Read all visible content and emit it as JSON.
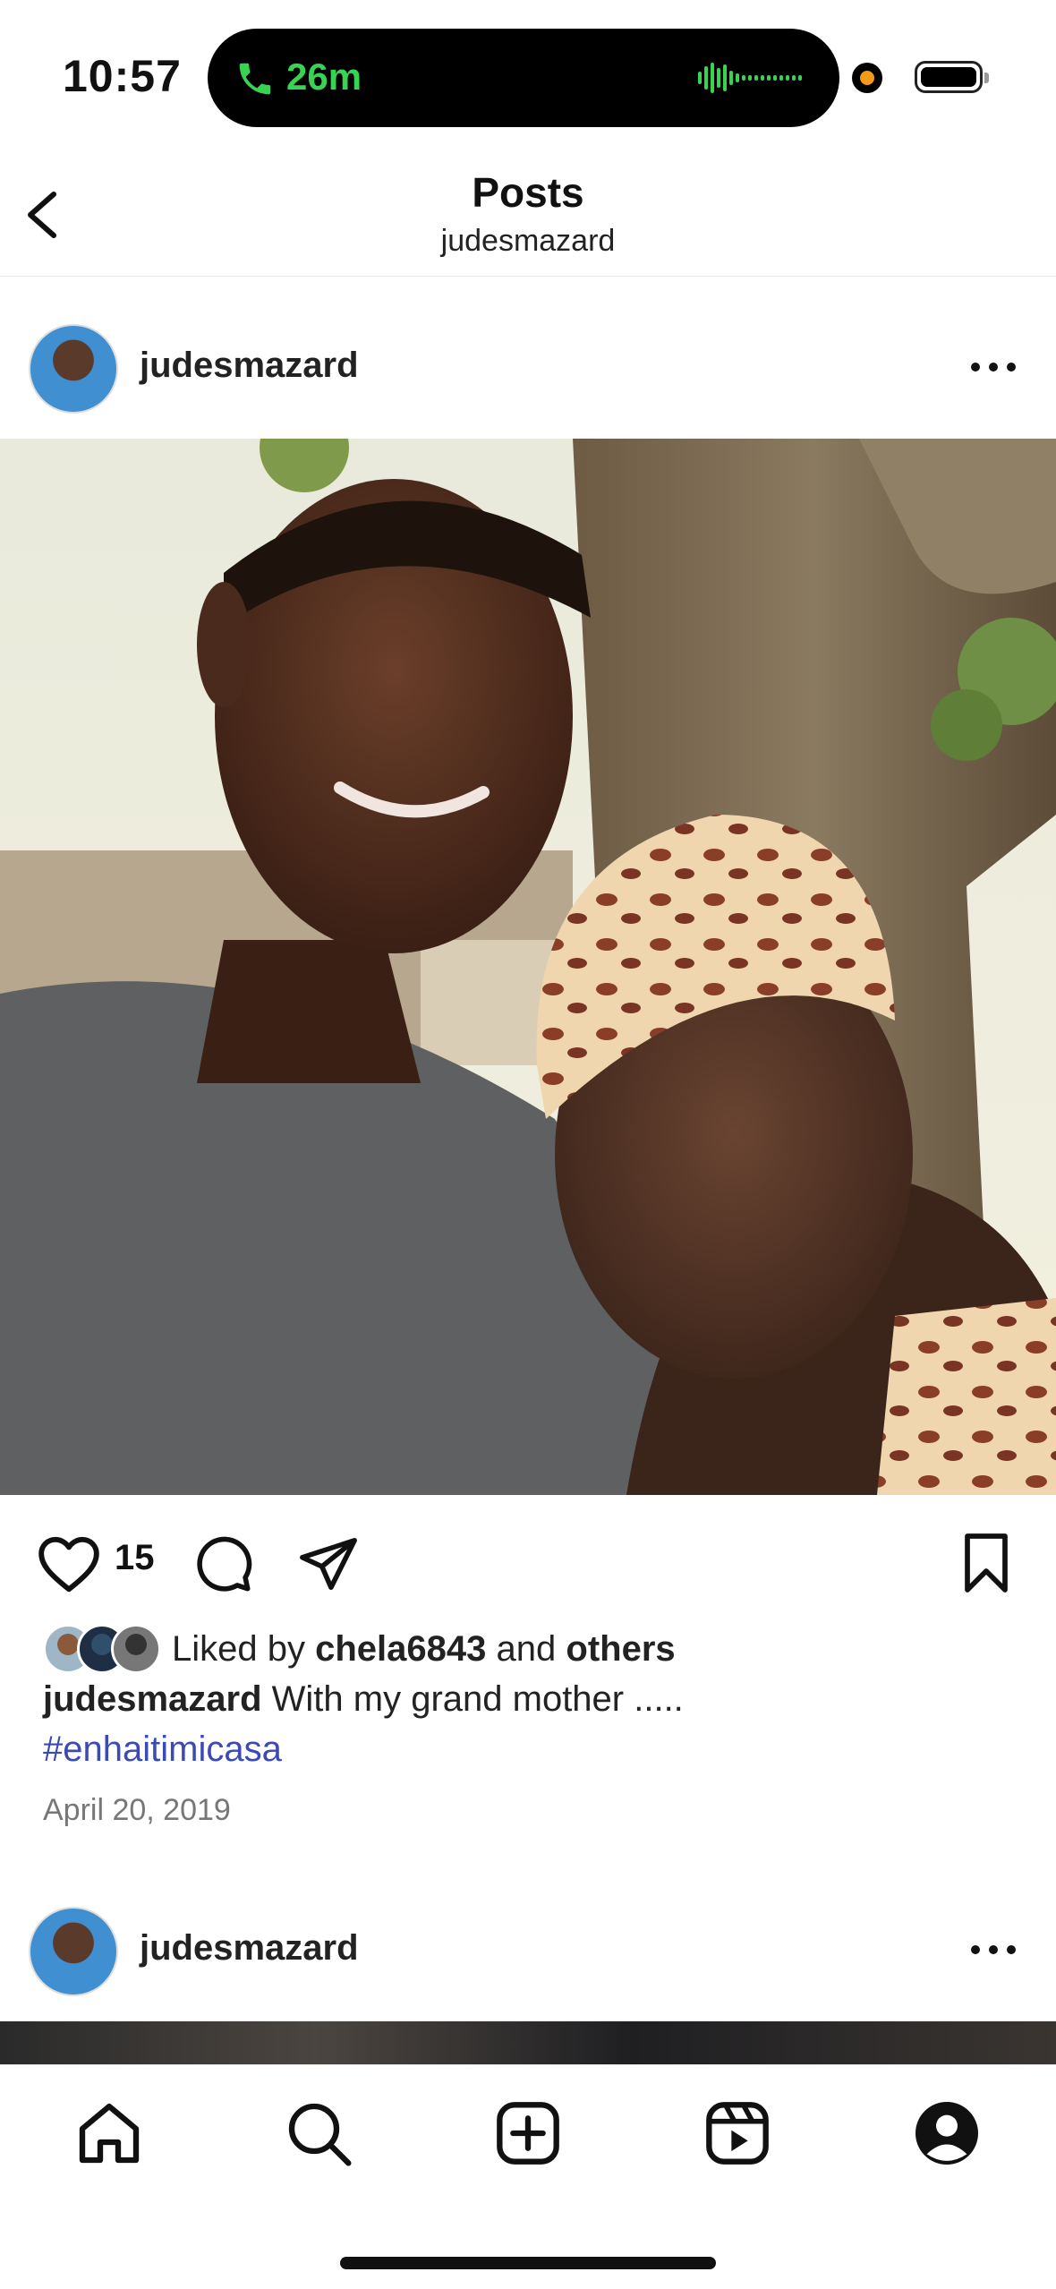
{
  "status": {
    "time": "10:57",
    "call_duration": "26m"
  },
  "header": {
    "title": "Posts",
    "subtitle": "judesmazard"
  },
  "posts": [
    {
      "username": "judesmazard",
      "like_count": "15",
      "liked_by_prefix": "Liked by",
      "liked_by_user": "chela6843",
      "liked_by_and": "and",
      "liked_by_others": "others",
      "caption_user": "judesmazard",
      "caption_text": "With my grand mother .....",
      "hashtag": "#enhaitimicasa",
      "date": "April 20, 2019"
    },
    {
      "username": "judesmazard"
    }
  ],
  "icons": {
    "back": "chevron-left-icon",
    "more": "more-horizontal-icon",
    "like": "heart-icon",
    "comment": "comment-icon",
    "share": "send-icon",
    "save": "bookmark-icon",
    "tabs": [
      "home-icon",
      "search-icon",
      "add-post-icon",
      "reels-icon",
      "profile-icon"
    ]
  },
  "colors": {
    "call_green": "#39d353",
    "hashtag_blue": "#3c4ab5",
    "text": "#111111"
  }
}
